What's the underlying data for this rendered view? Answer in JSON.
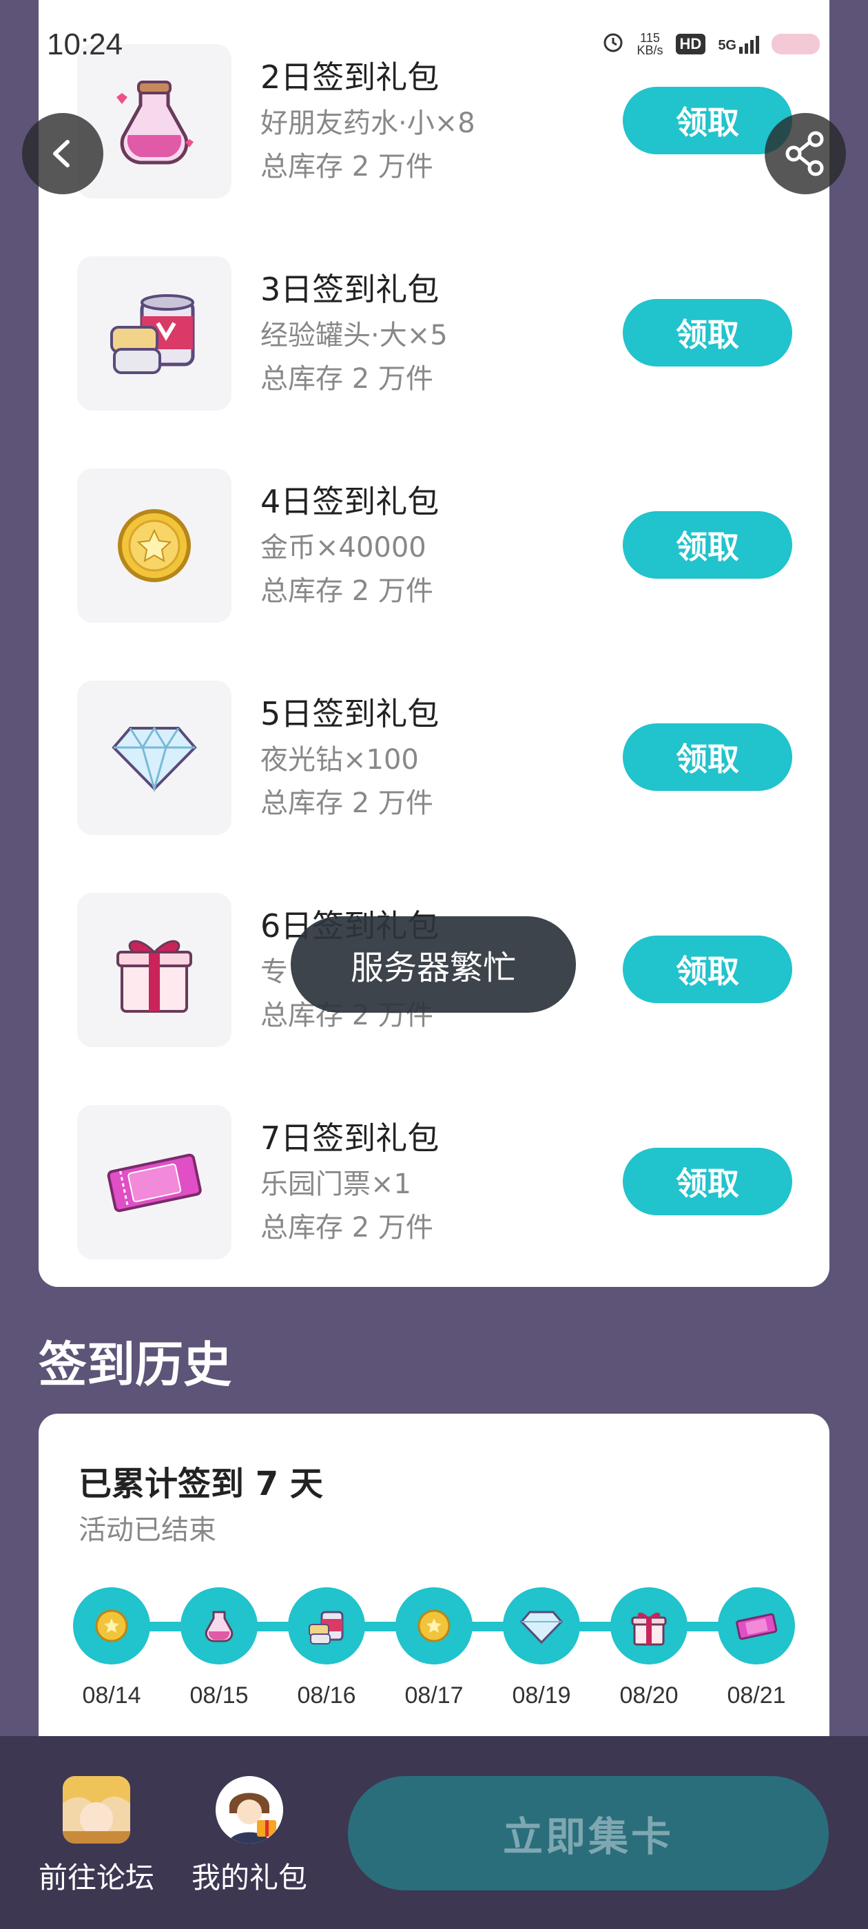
{
  "status_bar": {
    "time": "10:24",
    "net_speed_value": "115",
    "net_speed_unit": "KB/s",
    "hd": "HD",
    "network": "5G"
  },
  "icons": {
    "back": "chevron-left-icon",
    "share": "share-icon"
  },
  "gifts": [
    {
      "title": "2日签到礼包",
      "desc": "好朋友药水·小×8",
      "stock": "总库存 2 万件",
      "button": "领取",
      "icon": "potion-icon"
    },
    {
      "title": "3日签到礼包",
      "desc": "经验罐头·大×5",
      "stock": "总库存 2 万件",
      "button": "领取",
      "icon": "canned-food-icon"
    },
    {
      "title": "4日签到礼包",
      "desc": "金币×40000",
      "stock": "总库存 2 万件",
      "button": "领取",
      "icon": "gold-coin-icon"
    },
    {
      "title": "5日签到礼包",
      "desc": "夜光钻×100",
      "stock": "总库存 2 万件",
      "button": "领取",
      "icon": "diamond-icon"
    },
    {
      "title": "6日签到礼包",
      "desc": "专",
      "stock": "总库存 2 万件",
      "button": "领取",
      "icon": "gift-box-icon"
    },
    {
      "title": "7日签到礼包",
      "desc": "乐园门票×1",
      "stock": "总库存 2 万件",
      "button": "领取",
      "icon": "ticket-icon"
    }
  ],
  "toast": "服务器繁忙",
  "history": {
    "section_title": "签到历史",
    "count_text": "已累计签到 7 天",
    "status": "活动已结束",
    "dates": [
      "08/14",
      "08/15",
      "08/16",
      "08/17",
      "08/19",
      "08/20",
      "08/21"
    ]
  },
  "bottom_bar": {
    "forum_label": "前往论坛",
    "gifts_label": "我的礼包",
    "collect_label": "立即集卡"
  },
  "colors": {
    "accent": "#21c3cc",
    "background": "#5d5478",
    "bottom_bar": "#3d3752",
    "collect_button": "#2a6e7c"
  }
}
